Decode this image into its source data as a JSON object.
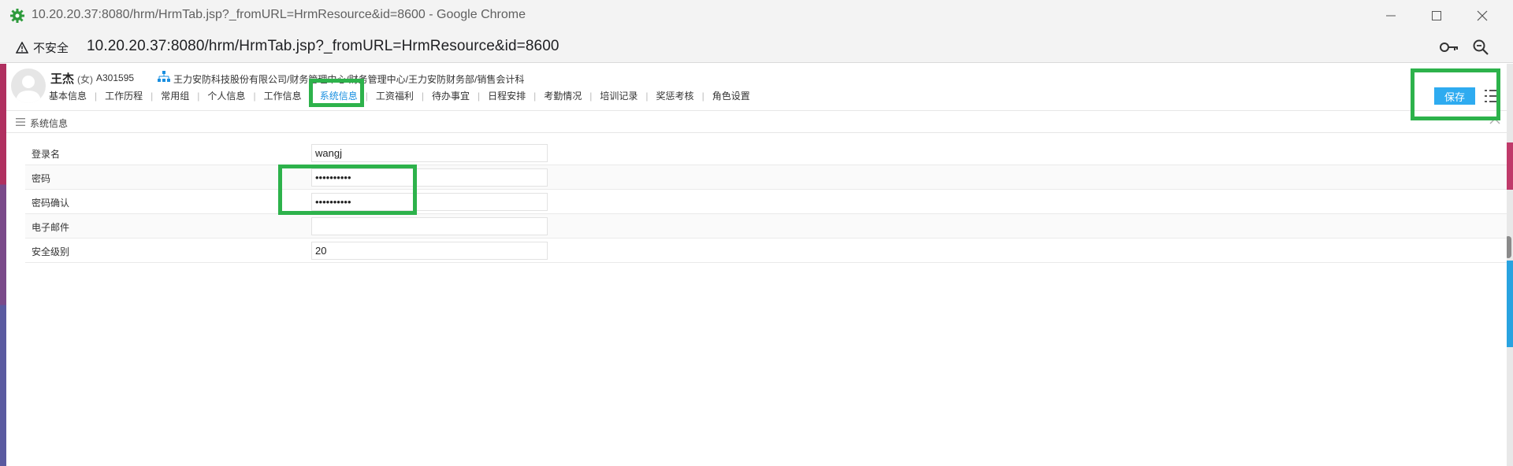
{
  "window": {
    "title": "10.20.20.37:8080/hrm/HrmTab.jsp?_fromURL=HrmResource&id=8600 - Google Chrome"
  },
  "addressbar": {
    "security_label": "不安全",
    "url": "10.20.20.37:8080/hrm/HrmTab.jsp?_fromURL=HrmResource&id=8600"
  },
  "employee": {
    "name": "王杰",
    "sex": "(女)",
    "id": "A301595",
    "org_path": "王力安防科技股份有限公司/财务管理中心/财务管理中心/王力安防财务部/销售会计科"
  },
  "tabs": [
    {
      "label": "基本信息"
    },
    {
      "label": "工作历程"
    },
    {
      "label": "常用组"
    },
    {
      "label": "个人信息"
    },
    {
      "label": "工作信息"
    },
    {
      "label": "系统信息"
    },
    {
      "label": "工资福利"
    },
    {
      "label": "待办事宜"
    },
    {
      "label": "日程安排"
    },
    {
      "label": "考勤情况"
    },
    {
      "label": "培训记录"
    },
    {
      "label": "奖惩考核"
    },
    {
      "label": "角色设置"
    }
  ],
  "active_tab": "系统信息",
  "toolbar": {
    "save_label": "保存"
  },
  "section": {
    "title": "系统信息"
  },
  "form": {
    "login_name": {
      "label": "登录名",
      "value": "wangj"
    },
    "password": {
      "label": "密码",
      "value": "••••••••••"
    },
    "password_confirm": {
      "label": "密码确认",
      "value": "••••••••••"
    },
    "email": {
      "label": "电子邮件",
      "value": ""
    },
    "security_level": {
      "label": "安全级别",
      "value": "20"
    }
  },
  "colors": {
    "accent": "#2eabf0",
    "active_tab": "#1a8fe0",
    "highlight_box": "#2db24b"
  },
  "icons": {
    "app": "green-gear-icon",
    "warning": "warning-triangle-icon",
    "key": "key-icon",
    "zoom": "zoom-out-icon",
    "org": "org-chart-icon",
    "menu": "list-menu-icon",
    "section": "hamburger-icon",
    "collapse": "chevron-up-icon"
  }
}
